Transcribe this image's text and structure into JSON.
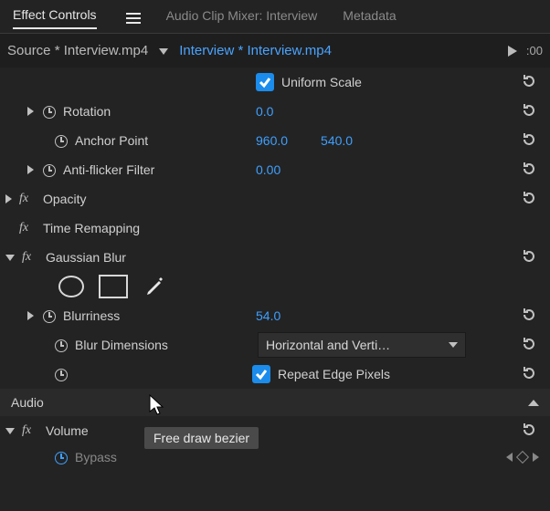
{
  "tabs": {
    "effectControls": "Effect Controls",
    "audioClipMixer": "Audio Clip Mixer: Interview",
    "metadata": "Metadata"
  },
  "header": {
    "source": "Source * Interview.mp4",
    "sequence": "Interview * Interview.mp4",
    "timecode": ":00"
  },
  "uniformScale": {
    "label": "Uniform Scale"
  },
  "rotation": {
    "label": "Rotation",
    "value": "0.0"
  },
  "anchor": {
    "label": "Anchor Point",
    "x": "960.0",
    "y": "540.0"
  },
  "antiFlicker": {
    "label": "Anti-flicker Filter",
    "value": "0.00"
  },
  "opacity": {
    "label": "Opacity"
  },
  "timeRemap": {
    "label": "Time Remapping"
  },
  "gaussian": {
    "label": "Gaussian Blur"
  },
  "blurriness": {
    "label": "Blurriness",
    "value": "54.0"
  },
  "blurDim": {
    "label": "Blur Dimensions",
    "value": "Horizontal and Verti…"
  },
  "repeatEdge": {
    "label": "Repeat Edge Pixels"
  },
  "audio": {
    "label": "Audio"
  },
  "volume": {
    "label": "Volume"
  },
  "bypass": {
    "label": "Bypass"
  },
  "tooltip": "Free draw bezier"
}
